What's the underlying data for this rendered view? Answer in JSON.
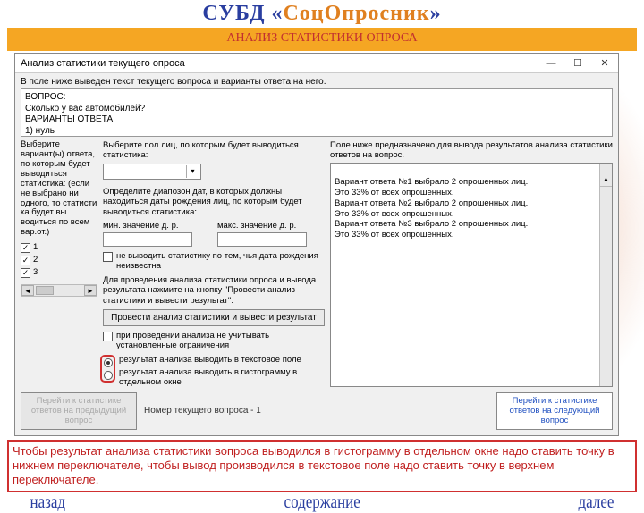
{
  "header": {
    "title_prefix": "СУБД «",
    "title_mid": "СоцОпросник",
    "title_suffix": "»",
    "subtitle": "АНАЛИЗ СТАТИСТИКИ ОПРОСА"
  },
  "window": {
    "title": "Анализ статистики текущего опроса",
    "min_icon": "—",
    "max_icon": "☐",
    "close_icon": "✕"
  },
  "top_hint": "В поле ниже выведен текст текущего вопроса и варианты ответа на него.",
  "question_block": "ВОПРОС:\nСколько у вас автомобилей?\nВАРИАНТЫ ОТВЕТА:\n1) нуль",
  "left": {
    "label": "Выберите вариант(ы) ответа, по которым будет выводиться статистика: (если не выбрано ни одного, то статисти ка будет вы водиться по всем вар.от.)",
    "options": [
      "1",
      "2",
      "3"
    ]
  },
  "mid": {
    "gender_label": "Выберите пол лиц, по которым будет выводиться статистика:",
    "range_label": "Определите диапозон дат, в которых должны находиться даты рождения лиц, по которым будет выводиться статистика:",
    "range_min": "мин. значение д. р.",
    "range_max": "макс. значение д. р.",
    "chk_nobirth": "не выводить статистику по тем, чья дата рождения неизвестна",
    "run_hint": "Для проведения анализа статистики опроса и вывода результата нажмите на кнопку \"Провести анализ статистики и вывести результат\":",
    "run_button": "Провести анализ статистики и вывести результат",
    "chk_nolimits": "при проведении анализа не учитывать установленные ограничения",
    "radio_text": "результат анализа выводить в текстовое поле",
    "radio_hist": "результат анализа выводить в гистограмму в отдельном окне"
  },
  "right": {
    "label": "Поле ниже предназначено для вывода результатов анализа статистики ответов на вопрос.",
    "result": "Вариант ответа №1 выбрало 2 опрошенных лиц.\nЭто 33% от всех опрошенных.\nВариант ответа №2 выбрало 2 опрошенных лиц.\nЭто 33% от всех опрошенных.\nВариант ответа №3 выбрало 2 опрошенных лиц.\nЭто 33% от всех опрошенных."
  },
  "bottom": {
    "prev": "Перейти к статистике ответов на предыдущий вопрос",
    "qnum_label": "Номер текущего вопроса - 1",
    "next": "Перейти к статистике ответов на следующий вопрос"
  },
  "instruction": "Чтобы результат анализа статистики вопроса выводился в гистограмму в отдельном окне надо ставить точку в нижнем переключателе, чтобы вывод производился в текстовое поле надо ставить точку в верхнем переключателе.",
  "footer": {
    "back": "назад",
    "toc": "содержание",
    "next": "далее"
  }
}
